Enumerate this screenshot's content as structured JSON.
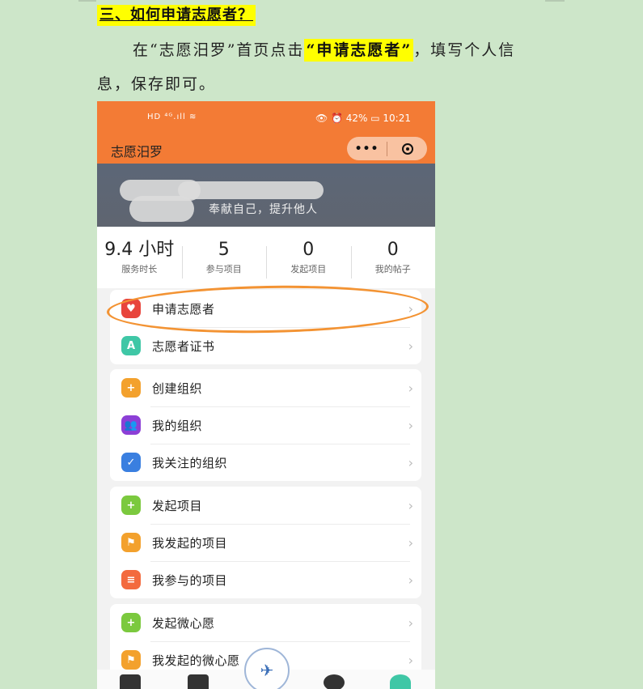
{
  "heading": "三、如何申请志愿者？",
  "para": {
    "before": "在“志愿汨罗”首页点击",
    "highlight": "“申请志愿者”",
    "after": "，填写个人信",
    "line2": "息，保存即可。"
  },
  "phone": {
    "status_left": "HD ⁴ᴳ.ıll ≋",
    "status_right": "👁 ⏰ 42% ▭ 10:21",
    "app_title": "志愿汨罗",
    "capsule_more": "•••",
    "slogan": "奉献自己，提升他人",
    "stats": [
      {
        "value": "9.4 小时",
        "label": "服务时长"
      },
      {
        "value": "5",
        "label": "参与项目"
      },
      {
        "value": "0",
        "label": "发起项目"
      },
      {
        "value": "0",
        "label": "我的帖子"
      }
    ],
    "groups": [
      [
        {
          "label": "申请志愿者",
          "icon": "heart-icon",
          "color": "#e8453c",
          "glyph": "♥"
        },
        {
          "label": "志愿者证书",
          "icon": "certificate-icon",
          "color": "#3fc7a6",
          "glyph": "A"
        }
      ],
      [
        {
          "label": "创建组织",
          "icon": "create-org-icon",
          "color": "#f3a12d",
          "glyph": "+"
        },
        {
          "label": "我的组织",
          "icon": "people-icon",
          "color": "#8c3fd6",
          "glyph": "👥"
        },
        {
          "label": "我关注的组织",
          "icon": "calendar-check-icon",
          "color": "#3a7fe0",
          "glyph": "✓"
        }
      ],
      [
        {
          "label": "发起项目",
          "icon": "plus-circle-icon",
          "color": "#7bc93e",
          "glyph": "+"
        },
        {
          "label": "我发起的项目",
          "icon": "flag-icon",
          "color": "#f3a12d",
          "glyph": "⚑"
        },
        {
          "label": "我参与的项目",
          "icon": "list-icon",
          "color": "#f36a3e",
          "glyph": "≡"
        }
      ],
      [
        {
          "label": "发起微心愿",
          "icon": "plus-circle-icon",
          "color": "#7bc93e",
          "glyph": "+"
        },
        {
          "label": "我发起的微心愿",
          "icon": "flag-icon",
          "color": "#f3a12d",
          "glyph": "⚑"
        }
      ]
    ],
    "chevron": "›"
  }
}
